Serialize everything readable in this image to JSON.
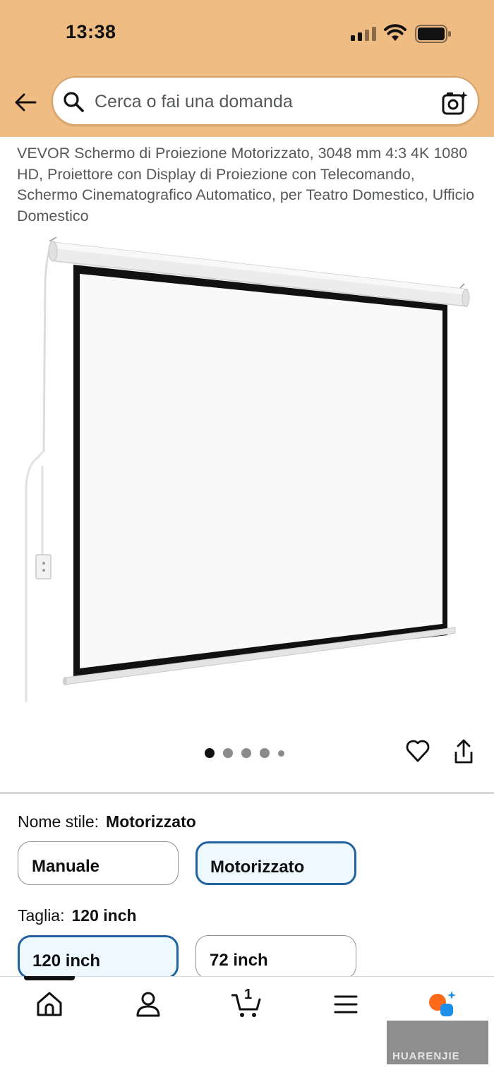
{
  "status": {
    "time": "13:38"
  },
  "search": {
    "placeholder": "Cerca o fai una domanda"
  },
  "product": {
    "title": "VEVOR Schermo di Proiezione Motorizzato, 3048 mm 4:3 4K 1080 HD, Proiettore con Display di Proiezione con Telecomando, Schermo Cinematografico Automatico, per Teatro Domestico, Ufficio Domestico",
    "image_count": 5,
    "active_image": 1
  },
  "options": {
    "style": {
      "label": "Nome stile:",
      "selected": "Motorizzato",
      "choices": [
        "Manuale",
        "Motorizzato"
      ]
    },
    "size": {
      "label": "Taglia:",
      "selected": "120 inch",
      "choices": [
        "120 inch",
        "72 inch"
      ]
    }
  },
  "navbar": {
    "items": [
      "home-icon",
      "account-icon",
      "cart-icon",
      "menu-icon",
      "rufus-icon"
    ],
    "cart_count": "1",
    "active": "home"
  },
  "watermark": {
    "text": "HUARENJIE"
  },
  "colors": {
    "header_bg": "#efbd84",
    "selected_border": "#2162a1",
    "selected_bg": "#edf8ff",
    "rufus_orange": "#ff6a1a",
    "rufus_blue": "#1c8fe8"
  }
}
